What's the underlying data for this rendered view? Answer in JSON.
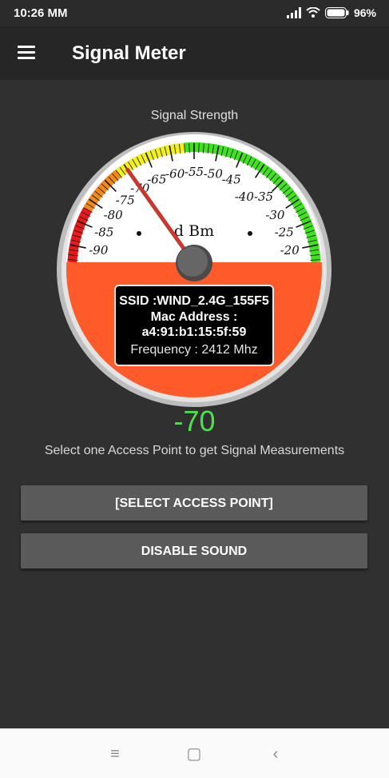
{
  "status_bar": {
    "time": "10:26 MM",
    "battery": "96%"
  },
  "app_bar": {
    "title": "Signal Meter",
    "menu_icon": "hamburger-menu-icon"
  },
  "gauge": {
    "title": "Signal Strength",
    "unit": "d Bm",
    "scale_labels": [
      "-90",
      "-85",
      "-80",
      "-75",
      "-70",
      "-65",
      "-60",
      "-55",
      "-50",
      "-45",
      "-40-35",
      "-30",
      "-25",
      "-20"
    ],
    "needle_value": -70,
    "colors": {
      "red": "#e8191a",
      "orange": "#f08a1e",
      "yellow": "#f1ef1f",
      "green": "#41e021",
      "bottom": "#ff5a2a",
      "bezel": "#c8c8c8"
    }
  },
  "info": {
    "ssid": "SSID :WIND_2.4G_155F5",
    "mac_label": "Mac Address :",
    "mac": "a4:91:b1:15:5f:59",
    "frequency": "Frequency : 2412 Mhz"
  },
  "reading": {
    "value": "-70"
  },
  "hint": "Select one Access Point to get Signal Measurements",
  "buttons": {
    "select": "[SELECT ACCESS POINT]",
    "sound": "DISABLE SOUND"
  },
  "nav": {
    "recent": "≡",
    "home": "▢",
    "back": "‹"
  }
}
